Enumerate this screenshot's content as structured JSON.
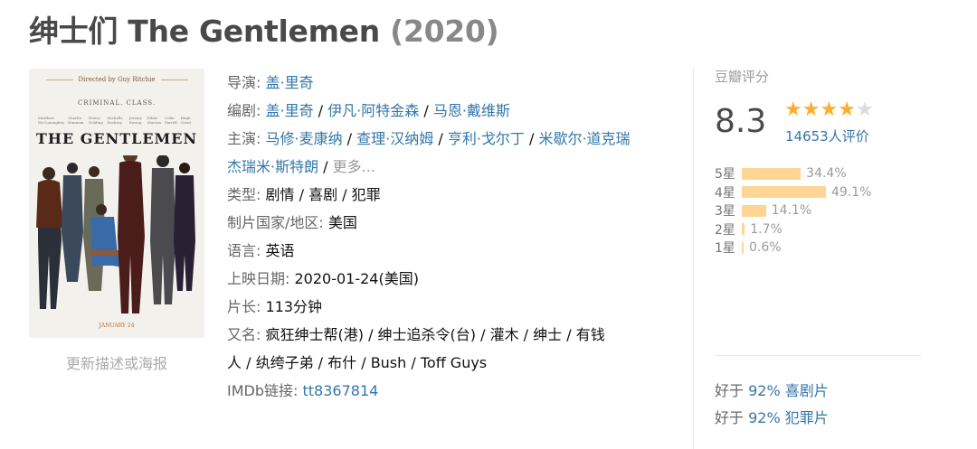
{
  "title": "绅士们 The Gentlemen",
  "year": "(2020)",
  "poster": {
    "directed_by": "Directed by Guy Ritchie",
    "tagline": "CRIMINAL. CLASS.",
    "cast_names": [
      "Matthew McConaughey",
      "Charlie Hunnam",
      "Henry Golding",
      "Michelle Dockery",
      "Jeremy Strong",
      "Eddie Marsan",
      "Colin Farrell",
      "Hugh Grant"
    ],
    "poster_title": "THE GENTLEMEN",
    "release_note": "JANUARY 24",
    "caption": "更新描述或海报"
  },
  "info": {
    "director_label": "导演:",
    "director": "盖·里奇",
    "writer_label": "编剧:",
    "writers": [
      "盖·里奇",
      "伊凡·阿特金森",
      "马恩·戴维斯"
    ],
    "cast_label": "主演:",
    "cast": [
      "马修·麦康纳",
      "查理·汉纳姆",
      "亨利·戈尔丁",
      "米歇尔·道克瑞",
      "杰瑞米·斯特朗"
    ],
    "more": "更多...",
    "genre_label": "类型:",
    "genre": "剧情 / 喜剧 / 犯罪",
    "country_label": "制片国家/地区:",
    "country": "美国",
    "language_label": "语言:",
    "language": "英语",
    "release_label": "上映日期:",
    "release": "2020-01-24(美国)",
    "runtime_label": "片长:",
    "runtime": "113分钟",
    "aka_label": "又名:",
    "aka_line1": "疯狂绅士帮(港) / 绅士追杀令(台) / 灌木 / 绅士 / 有钱",
    "aka_line2": "人 / 纨绔子弟 / 布什 / Bush / Toff Guys",
    "imdb_label": "IMDb链接:",
    "imdb": "tt8367814"
  },
  "rating": {
    "title": "豆瓣评分",
    "score": "8.3",
    "stars_filled": 4,
    "stars_total": 5,
    "star_on_color": "#ffac2d",
    "star_off_color": "#dcdcdc",
    "count": "14653人评价",
    "distribution": [
      {
        "label": "5星",
        "pct": "34.4%",
        "value": 34.4
      },
      {
        "label": "4星",
        "pct": "49.1%",
        "value": 49.1
      },
      {
        "label": "3星",
        "pct": "14.1%",
        "value": 14.1
      },
      {
        "label": "2星",
        "pct": "1.7%",
        "value": 1.7
      },
      {
        "label": "1星",
        "pct": "0.6%",
        "value": 0.6
      }
    ]
  },
  "better_than": [
    {
      "prefix": "好于",
      "link": "92% 喜剧片"
    },
    {
      "prefix": "好于",
      "link": "92% 犯罪片"
    }
  ],
  "colors": {
    "link": "#3377aa",
    "bar": "#ffd596"
  }
}
